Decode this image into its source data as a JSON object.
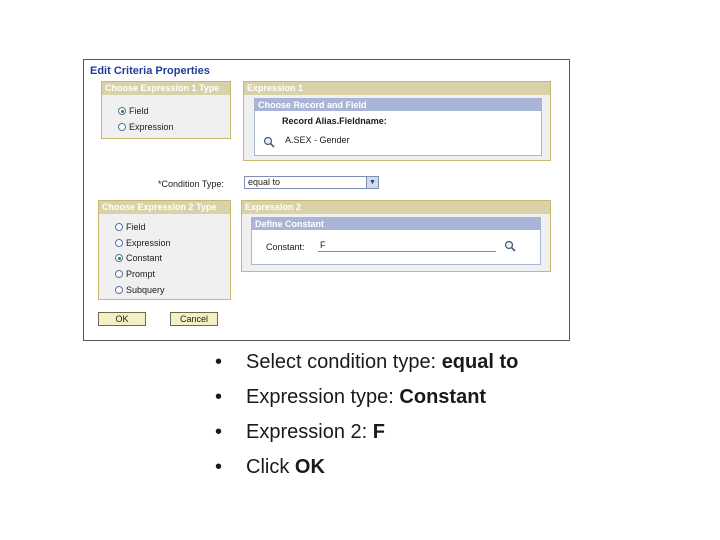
{
  "dialog": {
    "title": "Edit Criteria Properties",
    "expr1_type": {
      "header": "Choose Expression 1 Type",
      "options": [
        {
          "label": "Field",
          "selected": true
        },
        {
          "label": "Expression",
          "selected": false
        }
      ]
    },
    "expression1": {
      "header": "Expression 1",
      "sub_header": "Choose Record and Field",
      "field_label": "Record Alias.Fieldname:",
      "field_value": "A.SEX - Gender"
    },
    "condition": {
      "label": "*Condition Type:",
      "value": "equal to"
    },
    "expr2_type": {
      "header": "Choose Expression 2 Type",
      "options": [
        {
          "label": "Field",
          "selected": false
        },
        {
          "label": "Expression",
          "selected": false
        },
        {
          "label": "Constant",
          "selected": true
        },
        {
          "label": "Prompt",
          "selected": false
        },
        {
          "label": "Subquery",
          "selected": false
        }
      ]
    },
    "expression2": {
      "header": "Expression 2",
      "sub_header": "Define Constant",
      "constant_label": "Constant:",
      "constant_value": "F"
    },
    "buttons": {
      "ok": "OK",
      "cancel": "Cancel"
    }
  },
  "bullets": [
    {
      "text": "Select condition type: ",
      "bold": "equal to"
    },
    {
      "text": "Expression type: ",
      "bold": "Constant"
    },
    {
      "text": "Expression 2: ",
      "bold": "F"
    },
    {
      "text": "Click ",
      "bold": "OK"
    }
  ],
  "colors": {
    "title": "#1f3f8f",
    "group_header": "#d9d2a8",
    "sub_header": "#a9b5d6",
    "button": "#f3f0c6",
    "radio_selected": "#1c8c2c"
  }
}
